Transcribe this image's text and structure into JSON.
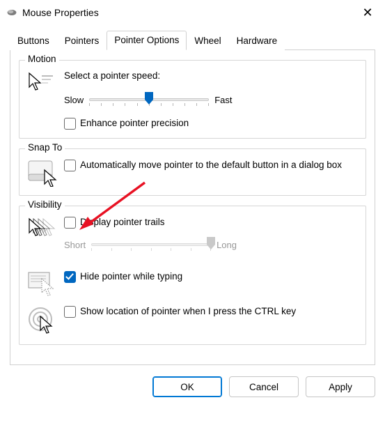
{
  "window": {
    "title": "Mouse Properties"
  },
  "tabs": {
    "buttons": "Buttons",
    "pointers": "Pointers",
    "options": "Pointer Options",
    "wheel": "Wheel",
    "hardware": "Hardware"
  },
  "motion": {
    "group": "Motion",
    "select": "Select a pointer speed:",
    "slow": "Slow",
    "fast": "Fast",
    "enhance": "Enhance pointer precision"
  },
  "snap": {
    "group": "Snap To",
    "auto": "Automatically move pointer to the default button in a dialog box"
  },
  "vis": {
    "group": "Visibility",
    "trails": "Display pointer trails",
    "short": "Short",
    "long": "Long",
    "hide": "Hide pointer while typing",
    "ctrl": "Show location of pointer when I press the CTRL key"
  },
  "buttons": {
    "ok": "OK",
    "cancel": "Cancel",
    "apply": "Apply"
  }
}
